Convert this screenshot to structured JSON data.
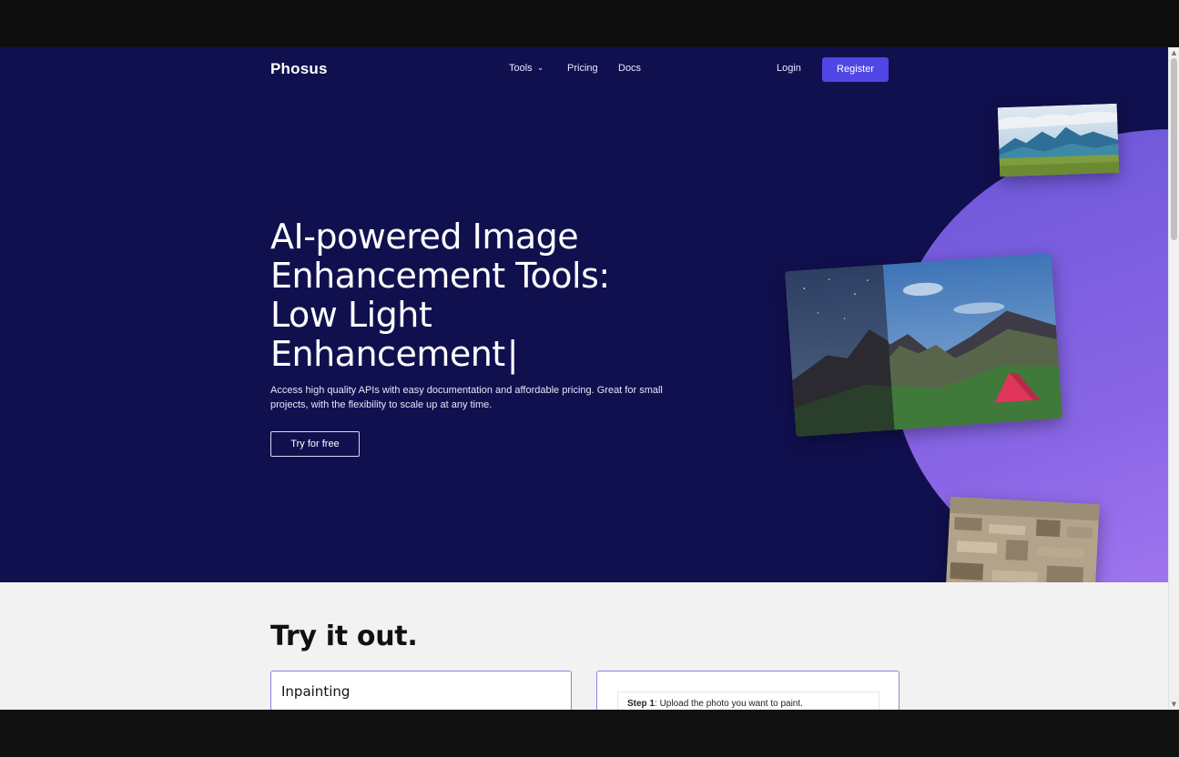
{
  "nav": {
    "logo": "Phosus",
    "tools_label": "Tools",
    "pricing_label": "Pricing",
    "docs_label": "Docs",
    "login_label": "Login",
    "register_label": "Register"
  },
  "hero": {
    "headline_line1": "AI-powered Image",
    "headline_line2": "Enhancement Tools:",
    "headline_line3": "Low Light",
    "headline_line4": "Enhancement",
    "cursor": "|",
    "subtext": "Access high quality APIs with easy documentation and affordable pricing. Great for small projects, with the flexibility to scale up at any time.",
    "cta_label": "Try for free"
  },
  "try_section": {
    "title": "Try it out.",
    "panel_left_title": "Inpainting",
    "step_label": "Step 1",
    "step_text": ": Upload the photo you want to paint."
  },
  "colors": {
    "hero_bg": "#11104f",
    "accent": "#4f46e5",
    "blob": "#8a66e6"
  }
}
